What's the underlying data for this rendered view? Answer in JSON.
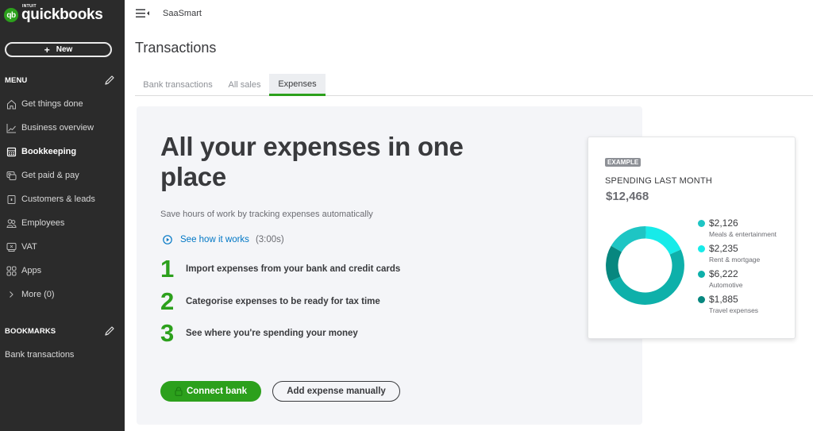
{
  "brand": {
    "intuit": "INTUIT",
    "name": "quickbooks",
    "badge": "qb"
  },
  "sidebar": {
    "new_label": "New",
    "menu_heading": "MENU",
    "items": [
      {
        "label": "Get things done",
        "icon": "home-icon"
      },
      {
        "label": "Business overview",
        "icon": "chart-line-icon"
      },
      {
        "label": "Bookkeeping",
        "icon": "calculator-icon",
        "active": true
      },
      {
        "label": "Get paid & pay",
        "icon": "payment-icon"
      },
      {
        "label": "Customers & leads",
        "icon": "contact-card-icon"
      },
      {
        "label": "Employees",
        "icon": "people-icon"
      },
      {
        "label": "VAT",
        "icon": "vat-icon"
      },
      {
        "label": "Apps",
        "icon": "apps-grid-icon"
      },
      {
        "label": "More (0)",
        "icon": "chevron-right-icon"
      }
    ],
    "bookmarks_heading": "BOOKMARKS",
    "bookmarks": [
      "Bank transactions"
    ]
  },
  "header": {
    "company": "SaaSmart",
    "page_title": "Transactions"
  },
  "tabs": [
    {
      "label": "Bank transactions",
      "active": false
    },
    {
      "label": "All sales",
      "active": false
    },
    {
      "label": "Expenses",
      "active": true
    }
  ],
  "promo": {
    "headline": "All your expenses in one place",
    "subtitle": "Save hours of work by tracking expenses automatically",
    "video_link": "See how it works",
    "video_duration": "(3:00s)",
    "steps": [
      {
        "num": "1",
        "text": "Import expenses from your bank and credit cards"
      },
      {
        "num": "2",
        "text": "Categorise expenses to be ready for tax time"
      },
      {
        "num": "3",
        "text": "See where you're spending your money"
      }
    ],
    "connect_bank_label": "Connect bank",
    "add_manual_label": "Add expense manually"
  },
  "example_card": {
    "badge": "EXAMPLE",
    "label": "SPENDING LAST MONTH",
    "total": "$12,468"
  },
  "chart_data": {
    "type": "pie",
    "title": "SPENDING LAST MONTH",
    "donut": true,
    "legend_position": "right",
    "categories": [
      "Meals & entertainment",
      "Rent & mortgage",
      "Automotive",
      "Travel expenses"
    ],
    "values": [
      2126,
      2235,
      6222,
      1885
    ],
    "labels": [
      "$2,126",
      "$2,235",
      "$6,222",
      "$1,885"
    ],
    "colors": [
      "#1ec5c4",
      "#17ebe9",
      "#0eb0aa",
      "#07877f"
    ],
    "start_angle_deg": -60
  },
  "colors": {
    "brand_green": "#2ca01c",
    "link_blue": "#0077c5",
    "sidebar_bg": "#2b2b2b"
  }
}
